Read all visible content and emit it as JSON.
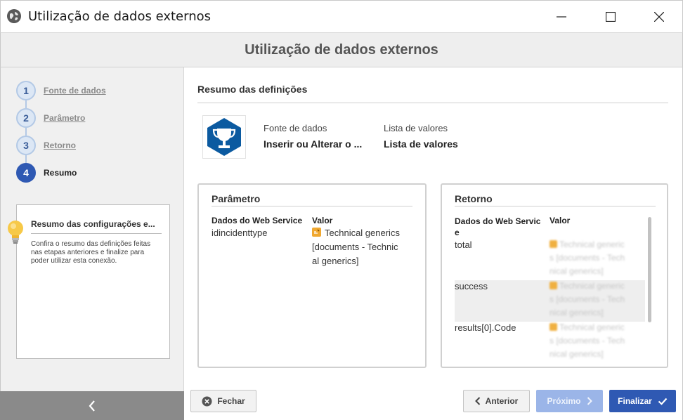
{
  "window": {
    "title": "Utilização de dados externos"
  },
  "header": {
    "title": "Utilização de dados externos"
  },
  "sidebar": {
    "steps": [
      {
        "number": "1",
        "label": "Fonte de dados"
      },
      {
        "number": "2",
        "label": "Parâmetro"
      },
      {
        "number": "3",
        "label": "Retorno"
      },
      {
        "number": "4",
        "label": "Resumo"
      }
    ],
    "active_step": 4,
    "tip": {
      "title": "Resumo das configurações e...",
      "text": "Confira o resumo das definições feitas nas etapas anteriores e finalize para poder utilizar esta conexão."
    }
  },
  "main": {
    "section_title": "Resumo das definições",
    "source_label": "Fonte de dados",
    "source_value": "Inserir ou Alterar o ...",
    "list_label": "Lista de valores",
    "list_value": "Lista de valores",
    "parametro": {
      "title": "Parâmetro",
      "col_name": "Dados do Web Service",
      "col_value": "Valor",
      "row_name": "idincidenttype",
      "row_value_line1": "Technical generics",
      "row_value_line2": "[documents - Technic",
      "row_value_line3": "al generics]"
    },
    "retorno": {
      "title": "Retorno",
      "col_name_line1": "Dados do Web Servic",
      "col_name_line2": "e",
      "col_value": "Valor",
      "rows": [
        {
          "name": "total",
          "value_line1": "Technical generic",
          "value_line2": "s [documents - Tech",
          "value_line3": "nical generics]"
        },
        {
          "name": "success",
          "value_line1": "Technical generic",
          "value_line2": "s [documents - Tech",
          "value_line3": "nical generics]"
        },
        {
          "name": "results[0].Code",
          "value_line1": "Technical generic",
          "value_line2": "s [documents - Tech",
          "value_line3": "nical generics]"
        }
      ]
    }
  },
  "footer": {
    "close_label": "Fechar",
    "prev_label": "Anterior",
    "next_label": "Próximo",
    "finish_label": "Finalizar"
  },
  "colors": {
    "accent": "#2f59b3",
    "disabled_button": "#9bb5e8",
    "step_inactive": "#dce7f5"
  }
}
